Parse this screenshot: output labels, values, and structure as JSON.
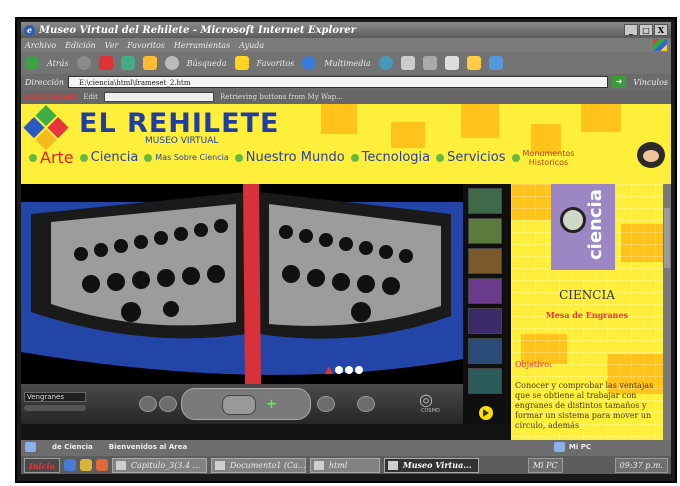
{
  "window": {
    "title": "Museo Virtual del Rehilete - Microsoft Internet Explorer",
    "controls": [
      "_",
      "□",
      "X"
    ]
  },
  "menu": [
    "Archivo",
    "Edición",
    "Ver",
    "Favoritos",
    "Herramientas",
    "Ayuda"
  ],
  "toolbar": {
    "back": "Atrás",
    "search": "Búsqueda",
    "favorites": "Favoritos",
    "multimedia": "Multimedia"
  },
  "address": {
    "label": "Dirección",
    "url": "E:\\ciencia\\html\\frameset_2.htm",
    "links": "Vínculos"
  },
  "looksmart": {
    "logo": "LOOKSMART",
    "edit": "Edit",
    "status": "Retrieving buttons from My Wap..."
  },
  "site": {
    "brand": "EL REHILETE",
    "museum": "MUSEO VIRTUAL",
    "nav": [
      "Arte",
      "Ciencia",
      "Mas Sobre Ciencia",
      "Nuestro Mundo",
      "Tecnologia",
      "Servicios"
    ],
    "nav_two_line": [
      "Monumentos",
      "Historicos"
    ]
  },
  "viewer": {
    "name": "Vengranes",
    "logo": "COSMO"
  },
  "science": {
    "title": "CIENCIA",
    "subtitle": "Mesa de Engranes",
    "objective_label": "Objetivo:",
    "body": "Conocer y comprobar las ventajas que se obtiene al trabajar con engranes de distintos tamaños y formar un sistema para mover un círculo, además",
    "logo_word": "ciencia"
  },
  "status": {
    "left": "de Ciencia",
    "msg": "Bienvenidos al Area",
    "zone": "Mi PC"
  },
  "taskbar": {
    "start": "Inicio",
    "tasks": [
      "Capitulo_3(3.4 ...",
      "Documento1 (Ca...",
      "html",
      "Museo Virtua..."
    ],
    "tray": [
      "Mi PC",
      "09:37 p.m."
    ]
  }
}
